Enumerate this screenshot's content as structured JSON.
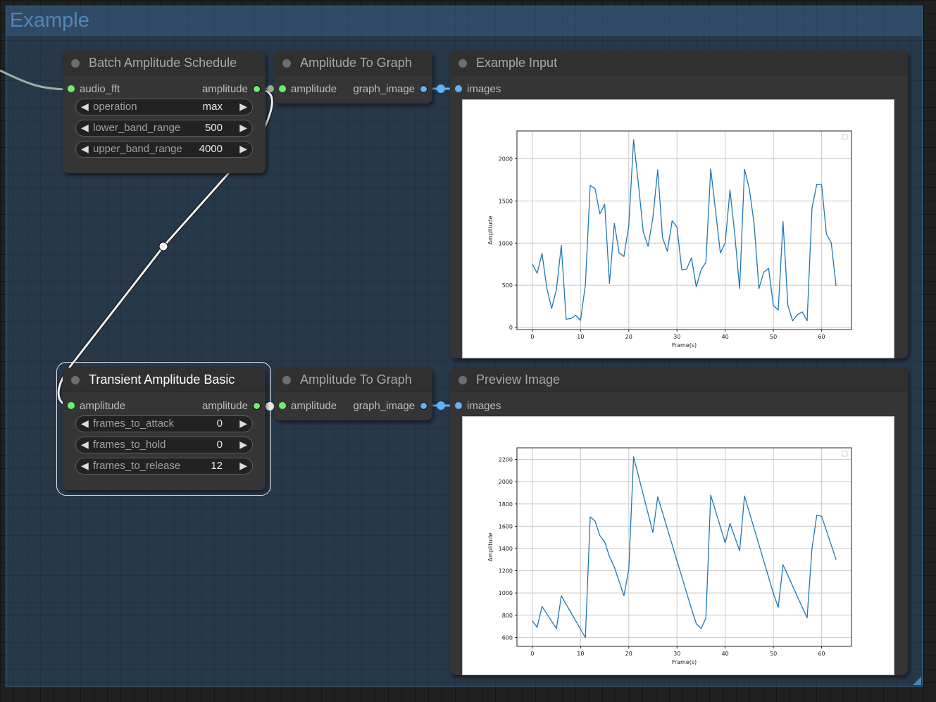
{
  "group": {
    "title": "Example"
  },
  "nodes": {
    "batch_amplitude_schedule": {
      "title": "Batch Amplitude Schedule",
      "input_label": "audio_fft",
      "output_label": "amplitude",
      "widgets": [
        {
          "label": "operation",
          "value": "max"
        },
        {
          "label": "lower_band_range",
          "value": "500"
        },
        {
          "label": "upper_band_range",
          "value": "4000"
        }
      ]
    },
    "amplitude_to_graph_1": {
      "title": "Amplitude To Graph",
      "input_label": "amplitude",
      "output_label": "graph_image"
    },
    "example_input": {
      "title": "Example Input",
      "input_label": "images"
    },
    "transient_amplitude_basic": {
      "title": "Transient Amplitude Basic",
      "input_label": "amplitude",
      "output_label": "amplitude",
      "widgets": [
        {
          "label": "frames_to_attack",
          "value": "0"
        },
        {
          "label": "frames_to_hold",
          "value": "0"
        },
        {
          "label": "frames_to_release",
          "value": "12"
        }
      ]
    },
    "amplitude_to_graph_2": {
      "title": "Amplitude To Graph",
      "input_label": "amplitude",
      "output_label": "graph_image"
    },
    "preview_image": {
      "title": "Preview Image",
      "input_label": "images"
    }
  },
  "icons": {
    "arrow_left": "◀",
    "arrow_right": "▶"
  },
  "colors": {
    "line": "#1f77b4",
    "slot_amplitude": "#6bf06b",
    "slot_image": "#5fb4f7",
    "group": "#4f88b8"
  },
  "chart_data": [
    {
      "type": "line",
      "title": "",
      "xlabel": "Frame(s)",
      "ylabel": "Amplitude",
      "xlim": [
        -3.2,
        66.2
      ],
      "ylim": [
        -25,
        2330
      ],
      "xticks": [
        0,
        10,
        20,
        30,
        40,
        50,
        60
      ],
      "yticks": [
        0,
        500,
        1000,
        1500,
        2000
      ],
      "grid": true,
      "legend": "top-right (empty)",
      "x": [
        0,
        1,
        2,
        3,
        4,
        5,
        6,
        7,
        8,
        9,
        10,
        11,
        12,
        13,
        14,
        15,
        16,
        17,
        18,
        19,
        20,
        21,
        22,
        23,
        24,
        25,
        26,
        27,
        28,
        29,
        30,
        31,
        32,
        33,
        34,
        35,
        36,
        37,
        38,
        39,
        40,
        41,
        42,
        43,
        44,
        45,
        46,
        47,
        48,
        49,
        50,
        51,
        52,
        53,
        54,
        55,
        56,
        57,
        58,
        59,
        60,
        61,
        62,
        63
      ],
      "series": [
        {
          "name": "amplitude",
          "values": [
            750,
            642,
            878,
            467,
            225,
            453,
            973,
            97,
            106,
            142,
            83,
            509,
            1682,
            1646,
            1346,
            1460,
            523,
            1232,
            884,
            842,
            1210,
            2222,
            1700,
            1134,
            962,
            1301,
            1871,
            1065,
            903,
            1265,
            1190,
            681,
            692,
            826,
            481,
            684,
            773,
            1879,
            1384,
            884,
            1003,
            1629,
            1092,
            459,
            1876,
            1648,
            1231,
            461,
            656,
            700,
            259,
            206,
            1254,
            259,
            78,
            153,
            184,
            78,
            1412,
            1698,
            1693,
            1106,
            1003,
            492
          ]
        }
      ]
    },
    {
      "type": "line",
      "title": "",
      "xlabel": "Frame(s)",
      "ylabel": "Amplitude",
      "xlim": [
        -3.2,
        66.2
      ],
      "ylim": [
        520,
        2305
      ],
      "xticks": [
        0,
        10,
        20,
        30,
        40,
        50,
        60
      ],
      "yticks": [
        600,
        800,
        1000,
        1200,
        1400,
        1600,
        1800,
        2000,
        2200
      ],
      "grid": true,
      "legend": "top-right (empty)",
      "x": [
        0,
        1,
        2,
        3,
        4,
        5,
        6,
        7,
        8,
        9,
        10,
        11,
        12,
        13,
        14,
        15,
        16,
        17,
        18,
        19,
        20,
        21,
        22,
        23,
        24,
        25,
        26,
        27,
        28,
        29,
        30,
        31,
        32,
        33,
        34,
        35,
        36,
        37,
        38,
        39,
        40,
        41,
        42,
        43,
        44,
        45,
        46,
        47,
        48,
        49,
        50,
        51,
        52,
        53,
        54,
        55,
        56,
        57,
        58,
        59,
        60,
        61,
        62,
        63
      ],
      "series": [
        {
          "name": "amplitude",
          "values": [
            749,
            692,
            879,
            813,
            746,
            680,
            974,
            899,
            824,
            749,
            674,
            600,
            1684,
            1646,
            1516,
            1459,
            1327,
            1232,
            1104,
            976,
            1211,
            2224,
            2054,
            1884,
            1714,
            1543,
            1866,
            1722,
            1578,
            1434,
            1290,
            1146,
            1002,
            858,
            724,
            680,
            774,
            1879,
            1737,
            1595,
            1452,
            1626,
            1502,
            1379,
            1872,
            1726,
            1580,
            1434,
            1288,
            1142,
            996,
            871,
            1254,
            1158,
            1062,
            966,
            870,
            777,
            1400,
            1699,
            1690,
            1560,
            1430,
            1300
          ]
        }
      ]
    }
  ]
}
